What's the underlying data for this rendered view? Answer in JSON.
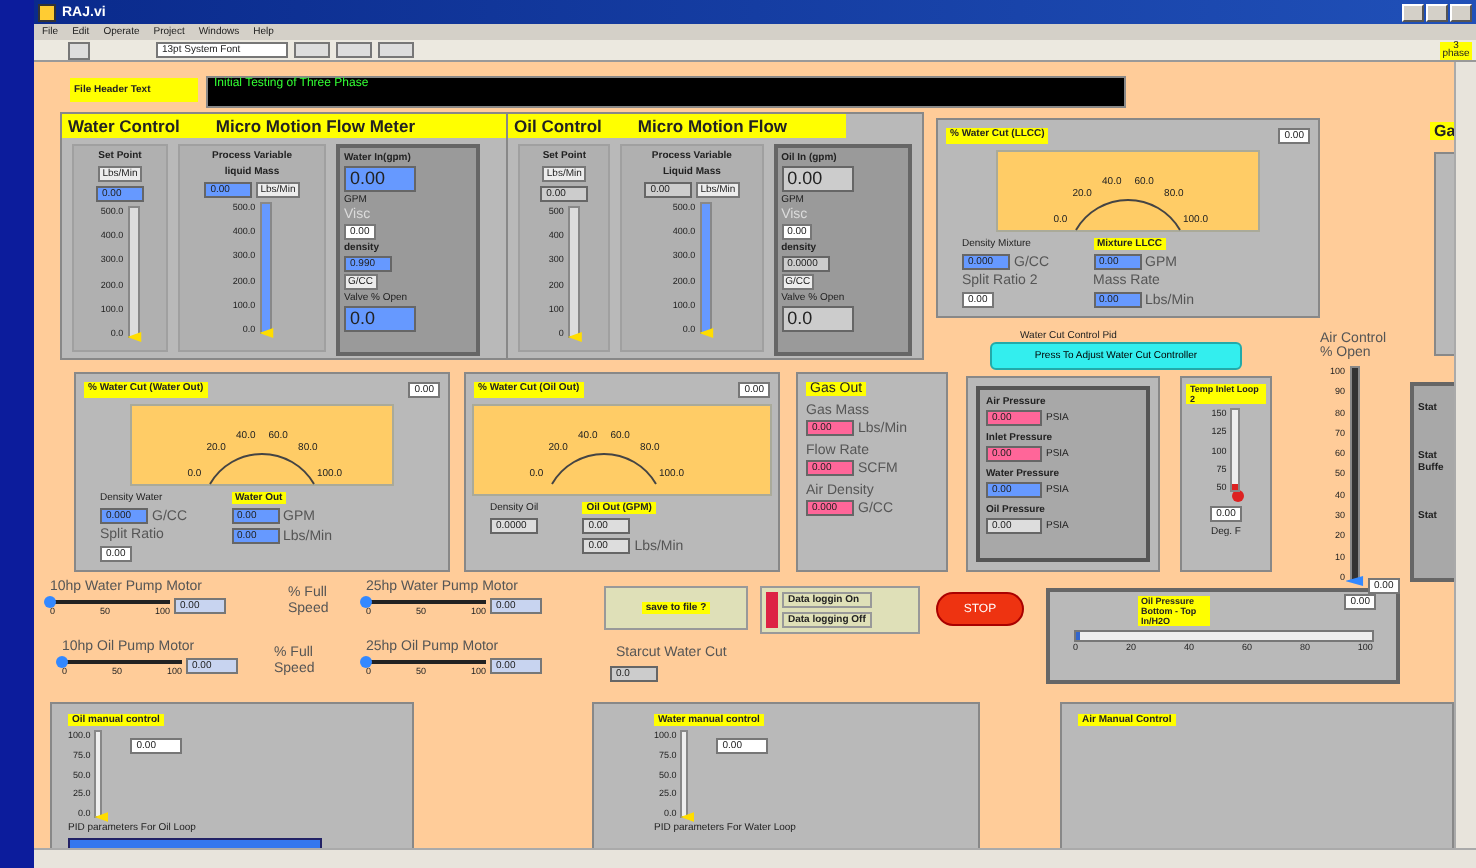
{
  "window": {
    "title": "RAJ.vi"
  },
  "menu": [
    "File",
    "Edit",
    "Operate",
    "Project",
    "Windows",
    "Help"
  ],
  "toolbar": {
    "font": "13pt System Font"
  },
  "corner_label": "3 phase",
  "header": {
    "label": "File Header Text",
    "value": "Initial Testing of Three Phase"
  },
  "control_panels": [
    {
      "title": "Water Control",
      "subtitle": "Micro Motion Flow Meter",
      "set_point": {
        "label": "Set Point",
        "unit": "Lbs/Min",
        "value": "0.00",
        "color": "#6699ff",
        "ticks": [
          "500.0",
          "400.0",
          "300.0",
          "200.0",
          "100.0",
          "0.0"
        ],
        "level": 0
      },
      "process_variable": {
        "label": "Process Variable",
        "sublabel": "liquid Mass",
        "value": "0.00",
        "color": "#6699ff",
        "unit": "Lbs/Min",
        "ticks": [
          "500.0",
          "400.0",
          "300.0",
          "200.0",
          "100.0",
          "0.0"
        ],
        "level": 0
      },
      "flow": {
        "label": "Water In(gpm)",
        "value": "0.00",
        "color": "#6699ff",
        "unit": "GPM",
        "visc_label": "Visc",
        "visc": "0.00",
        "density_label": "density",
        "density": {
          "value": "0.990",
          "color": "#6699ff"
        },
        "density_unit": "G/CC",
        "valve_label": "Valve % Open",
        "valve": {
          "value": "0.0",
          "color": "#6699ff"
        }
      }
    },
    {
      "title": "Oil Control",
      "subtitle": "Micro Motion Flow",
      "set_point": {
        "label": "Set Point",
        "unit": "Lbs/Min",
        "value": "0.00",
        "color": "#cccccc",
        "ticks": [
          "500",
          "400",
          "300",
          "200",
          "100",
          "0"
        ],
        "level": 0
      },
      "process_variable": {
        "label": "Process Variable",
        "sublabel": "Liquid Mass",
        "value": "0.00",
        "color": "#cccccc",
        "unit": "Lbs/Min",
        "ticks": [
          "500.0",
          "400.0",
          "300.0",
          "200.0",
          "100.0",
          "0.0"
        ],
        "level": 0
      },
      "flow": {
        "label": "Oil In (gpm)",
        "value": "0.00",
        "color": "#cccccc",
        "unit": "GPM",
        "visc_label": "Visc",
        "visc": "0.00",
        "density_label": "density",
        "density": {
          "value": "0.0000",
          "color": "#cccccc"
        },
        "density_unit": "G/CC",
        "valve_label": "Valve % Open",
        "valve": {
          "value": "0.0",
          "color": "#cccccc"
        }
      }
    }
  ],
  "gauge_panels": [
    {
      "label": "% Water Cut (LLCC)",
      "value": "0.00",
      "ticks": [
        "0.0",
        "20.0",
        "40.0",
        "60.0",
        "80.0",
        "100.0"
      ],
      "left": [
        {
          "kind": "text",
          "text": "Density Mixture"
        },
        {
          "kind": "reading",
          "value": "0.000",
          "unit": "G/CC",
          "color": "#6699ff"
        },
        {
          "kind": "big",
          "text": "Split Ratio 2"
        },
        {
          "kind": "plain",
          "text": "0.00"
        }
      ],
      "right": [
        {
          "kind": "tag",
          "text": "Mixture LLCC"
        },
        {
          "kind": "reading",
          "value": "0.00",
          "unit": "GPM",
          "color": "#6699ff"
        },
        {
          "kind": "big",
          "text": "Mass Rate"
        },
        {
          "kind": "reading",
          "value": "0.00",
          "unit": "Lbs/Min",
          "color": "#6699ff"
        }
      ]
    },
    {
      "label": "% Water Cut (Water Out)",
      "value": "0.00",
      "ticks": [
        "0.0",
        "20.0",
        "40.0",
        "60.0",
        "80.0",
        "100.0"
      ],
      "left": [
        {
          "kind": "text",
          "text": "Density Water"
        },
        {
          "kind": "reading",
          "value": "0.000",
          "unit": "G/CC",
          "color": "#6699ff"
        },
        {
          "kind": "big",
          "text": "Split Ratio"
        },
        {
          "kind": "plain",
          "text": "0.00"
        }
      ],
      "right": [
        {
          "kind": "tag",
          "text": "Water Out"
        },
        {
          "kind": "reading",
          "value": "0.00",
          "unit": "GPM",
          "color": "#6699ff"
        },
        {
          "kind": "reading",
          "value": "0.00",
          "unit": "Lbs/Min",
          "color": "#6699ff"
        }
      ]
    },
    {
      "label": "% Water Cut (Oil Out)",
      "value": "0.00",
      "ticks": [
        "0.0",
        "20.0",
        "40.0",
        "60.0",
        "80.0",
        "100.0"
      ],
      "left": [
        {
          "kind": "text",
          "text": "Density Oil"
        },
        {
          "kind": "reading",
          "value": "0.0000",
          "color": "#dddddd"
        }
      ],
      "right": [
        {
          "kind": "tag",
          "text": "Oil Out (GPM)"
        },
        {
          "kind": "reading",
          "value": "0.00",
          "color": "#dddddd"
        },
        {
          "kind": "reading",
          "value": "0.00",
          "unit": "Lbs/Min",
          "color": "#dddddd"
        }
      ]
    }
  ],
  "gas_out": {
    "title": "Gas Out",
    "readings": [
      {
        "label": "Gas Mass",
        "value": "0.00",
        "unit": "Lbs/Min",
        "color": "#ff6699"
      },
      {
        "label": "Flow Rate",
        "value": "0.00",
        "unit": "SCFM",
        "color": "#ff6699"
      },
      {
        "label": "Air Density",
        "value": "0.000",
        "unit": "G/CC",
        "color": "#ff6699"
      }
    ]
  },
  "pid": {
    "label": "Water Cut Control Pid",
    "button": "Press To Adjust Water Cut Controller"
  },
  "pressures": [
    {
      "label": "Air Pressure",
      "value": "0.00",
      "unit": "PSIA",
      "color": "#ff6699"
    },
    {
      "label": "Inlet Pressure",
      "value": "0.00",
      "unit": "PSIA",
      "color": "#ff6699"
    },
    {
      "label": "Water Pressure",
      "value": "0.00",
      "unit": "PSIA",
      "color": "#6699ff"
    },
    {
      "label": "Oil Pressure",
      "value": "0.00",
      "unit": "PSIA",
      "color": "#dddddd"
    }
  ],
  "temp": {
    "label": "Temp Inlet Loop 2",
    "ticks": [
      "150",
      "125",
      "100",
      "75",
      "50"
    ],
    "level": 0,
    "value": "0.00",
    "unit": "Deg. F"
  },
  "air_control": {
    "label": "Air Control % Open",
    "ticks": [
      "100",
      "90",
      "80",
      "70",
      "60",
      "50",
      "40",
      "30",
      "20",
      "10",
      "0"
    ],
    "level": 0,
    "value": "0.00"
  },
  "gas_panel": {
    "title": "Ga"
  },
  "status_panel": {
    "labels": [
      "Stat",
      "Stat Buffe",
      "Stat"
    ]
  },
  "pumps": [
    {
      "label": "10hp Water Pump Motor",
      "ticks": [
        "0",
        "50",
        "100"
      ],
      "level": 0,
      "value": "0.00"
    },
    {
      "label": "25hp Water Pump Motor",
      "ticks": [
        "0",
        "50",
        "100"
      ],
      "level": 0,
      "value": "0.00"
    },
    {
      "label": "10hp Oil Pump Motor",
      "ticks": [
        "0",
        "50",
        "100"
      ],
      "level": 0,
      "value": "0.00"
    },
    {
      "label": "25hp Oil Pump Motor",
      "ticks": [
        "0",
        "50",
        "100"
      ],
      "level": 0,
      "value": "0.00"
    }
  ],
  "speed_labels": [
    "% Full Speed",
    "% Full Speed"
  ],
  "save": {
    "label": "save to file ?"
  },
  "logging": {
    "on": false,
    "items": [
      "Data loggin On",
      "Data logging Off"
    ]
  },
  "stop": "STOP",
  "starcut": {
    "label": "Starcut Water Cut",
    "value": "0.0"
  },
  "oil_pressure": {
    "label": "Oil Pressure Bottom - Top In/H2O",
    "value": "0.00",
    "ticks": [
      "0",
      "20",
      "40",
      "60",
      "80",
      "100"
    ],
    "level": 0
  },
  "manual": [
    {
      "kind": "slider",
      "title": "Oil manual control",
      "ticks": [
        "100.0",
        "75.0",
        "50.0",
        "25.0",
        "0.0"
      ],
      "level": 0,
      "value": "0.00",
      "pid_label": "PID parameters For Oil Loop",
      "pid_bar": true
    },
    {
      "kind": "slider",
      "title": "Water manual control",
      "ticks": [
        "100.0",
        "75.0",
        "50.0",
        "25.0",
        "0.0"
      ],
      "level": 0,
      "value": "0.00",
      "pid_label": "PID parameters For Water Loop",
      "pid_bar": false
    },
    {
      "kind": "empty",
      "title": "Air Manual Control"
    }
  ]
}
